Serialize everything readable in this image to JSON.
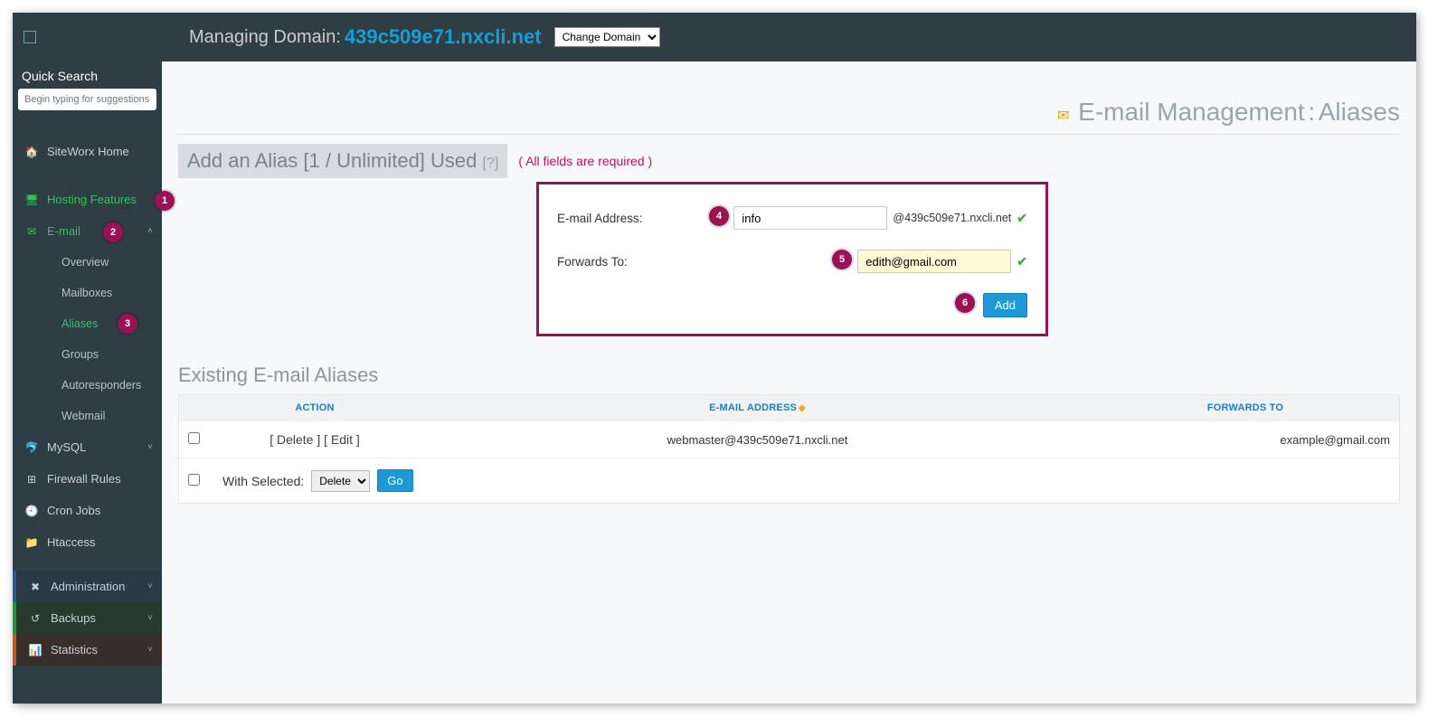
{
  "topbar": {
    "manage_label": "Managing Domain:",
    "domain": "439c509e71.nxcli.net",
    "change_domain_selected": "Change Domain"
  },
  "sidebar": {
    "quick_search_title": "Quick Search",
    "quick_search_placeholder": "Begin typing for suggestions",
    "items": [
      {
        "icon": "🏠",
        "label": "SiteWorx Home",
        "class": ""
      },
      {
        "icon": "🖥",
        "label": "Hosting Features",
        "class": "highlight"
      },
      {
        "icon": "✉️",
        "label": "E-mail",
        "class": "highlight",
        "expand": true
      },
      {
        "icon": "",
        "label": "Overview",
        "sub": true
      },
      {
        "icon": "",
        "label": "Mailboxes",
        "sub": true
      },
      {
        "icon": "",
        "label": "Aliases",
        "sub": true,
        "active": true
      },
      {
        "icon": "",
        "label": "Groups",
        "sub": true
      },
      {
        "icon": "",
        "label": "Autoresponders",
        "sub": true
      },
      {
        "icon": "",
        "label": "Webmail",
        "sub": true
      },
      {
        "icon": "🐬",
        "label": "MySQL"
      },
      {
        "icon": "⊞",
        "label": "Firewall Rules"
      },
      {
        "icon": "🕘",
        "label": "Cron Jobs"
      },
      {
        "icon": "📁",
        "label": "Htaccess"
      },
      {
        "icon": "✖",
        "label": "Administration",
        "block": "admin"
      },
      {
        "icon": "↺",
        "label": "Backups",
        "block": "backup"
      },
      {
        "icon": "📊",
        "label": "Statistics",
        "block": "stats"
      }
    ]
  },
  "page_header": {
    "main": "E-mail Management",
    "separator": ":",
    "sub": "Aliases"
  },
  "add_alias": {
    "title": "Add an Alias [1 / Unlimited] Used",
    "help": "[?]",
    "required_note": "( All fields are required )",
    "email_label": "E-mail Address:",
    "email_value": "info",
    "email_suffix": "@439c509e71.nxcli.net",
    "forwards_label": "Forwards To:",
    "forwards_value": "edith@gmail.com",
    "add_button": "Add"
  },
  "existing": {
    "title": "Existing E-mail Aliases",
    "columns": {
      "action": "ACTION",
      "email": "E-MAIL ADDRESS",
      "forwards": "FORWARDS TO"
    },
    "rows": [
      {
        "delete": "[ Delete ]",
        "edit": "[ Edit ]",
        "email": "webmaster@439c509e71.nxcli.net",
        "forwards": "example@gmail.com"
      }
    ],
    "with_selected_label": "With Selected:",
    "with_selected_action": "Delete",
    "go": "Go"
  },
  "step_badges": [
    "1",
    "2",
    "3",
    "4",
    "5",
    "6"
  ]
}
